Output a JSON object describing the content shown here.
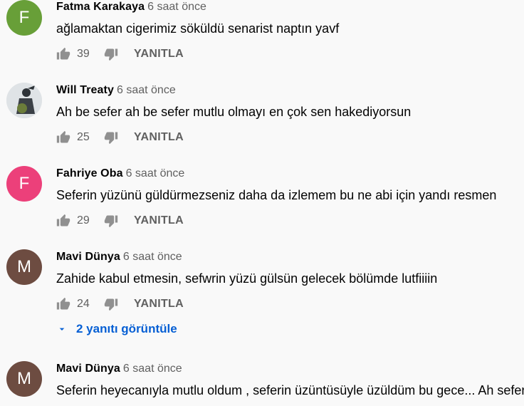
{
  "comments": [
    {
      "author": "Fatma Karakaya",
      "time": "6 saat önce",
      "text": "ağlamaktan cigerimiz söküldü senarist naptın yavf",
      "likes": "39",
      "reply_label": "YANITLA",
      "avatar_letter": "F",
      "avatar_color": "#689f38"
    },
    {
      "author": "Will Treaty",
      "time": "6 saat önce",
      "text": "Ah be sefer ah be sefer mutlu olmayı en çok sen hakediyorsun",
      "likes": "25",
      "reply_label": "YANITLA",
      "avatar_letter": "",
      "avatar_color": "#e8e8e8"
    },
    {
      "author": "Fahriye Oba",
      "time": "6 saat önce",
      "text": "Seferin yüzünü güldürmezseniz daha  da izlemem bu ne abi için yandı resmen",
      "likes": "29",
      "reply_label": "YANITLA",
      "avatar_letter": "F",
      "avatar_color": "#ec407a"
    },
    {
      "author": "Mavi Dünya",
      "time": "6 saat önce",
      "text": "Zahide kabul etmesin, sefwrin yüzü gülsün gelecek bölümde lutfiiiin",
      "likes": "24",
      "reply_label": "YANITLA",
      "avatar_letter": "M",
      "avatar_color": "#6d4c41"
    },
    {
      "author": "Mavi Dünya",
      "time": "6 saat önce",
      "text": "Seferin heyecanıyla mutlu oldum , seferin üzüntüsüyle üzüldüm bu gece... Ah sefer",
      "likes": "",
      "reply_label": "",
      "avatar_letter": "M",
      "avatar_color": "#6d4c41"
    }
  ],
  "replies_toggle": {
    "label": "2 yanıtı görüntüle",
    "color": "#065fd4"
  },
  "icons": {
    "like": "thumbs-up-icon",
    "dislike": "thumbs-down-icon",
    "expand": "caret-down-icon"
  }
}
